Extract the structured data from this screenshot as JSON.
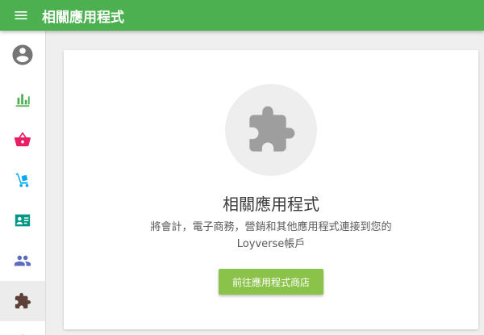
{
  "header": {
    "title": "相關應用程式",
    "menu_icon": "menu-icon",
    "color": "#4caf50"
  },
  "sidebar": {
    "items": [
      {
        "icon": "account-circle-icon",
        "color": "#757575"
      },
      {
        "icon": "bar-chart-icon",
        "color": "#4caf50"
      },
      {
        "icon": "basket-icon",
        "color": "#e91e63"
      },
      {
        "icon": "hand-truck-icon",
        "color": "#03a9f4"
      },
      {
        "icon": "id-card-icon",
        "color": "#009688"
      },
      {
        "icon": "people-icon",
        "color": "#5c6bc0"
      },
      {
        "icon": "puzzle-icon",
        "color": "#5d4037",
        "active": true
      },
      {
        "icon": "settings-icon",
        "color": "#757575"
      }
    ]
  },
  "card": {
    "icon": "puzzle-icon",
    "title": "相關應用程式",
    "description_line1": "將會計，電子商務，營銷和其他應用程式連接到您的",
    "description_line2": "Loyverse帳戶",
    "button_label": "前往應用程式商店",
    "button_color": "#8bc34a"
  }
}
